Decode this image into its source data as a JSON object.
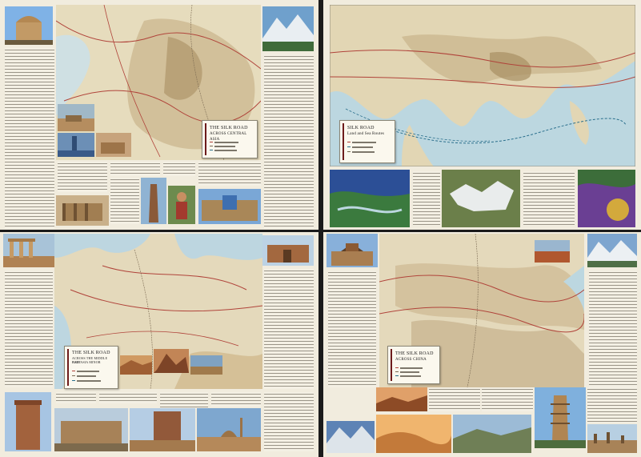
{
  "panels": {
    "central_asia": {
      "title_line1": "THE SILK ROAD",
      "title_line2": "ACROSS CENTRAL ASIA"
    },
    "land_and_sea": {
      "title_line1": "SILK ROAD",
      "title_line2": "Land and Sea Routes"
    },
    "west_asia": {
      "title_line1": "THE SILK ROAD",
      "title_line2": "ACROSS THE MIDDLE EAST",
      "title_line3": "AND ASIA MINOR"
    },
    "china": {
      "title_line1": "THE SILK ROAD",
      "title_line2": "ACROSS CHINA"
    }
  },
  "colors": {
    "paper": "#f1ecde",
    "route_red": "#b0433a",
    "title_bar": "#6d1b1b",
    "sea": "#bcd7e0",
    "land": "#e2d6b4",
    "mountain": "#b9a27a"
  },
  "icons": [
    "photo-thumbnail",
    "route-line",
    "legend-swatch"
  ]
}
